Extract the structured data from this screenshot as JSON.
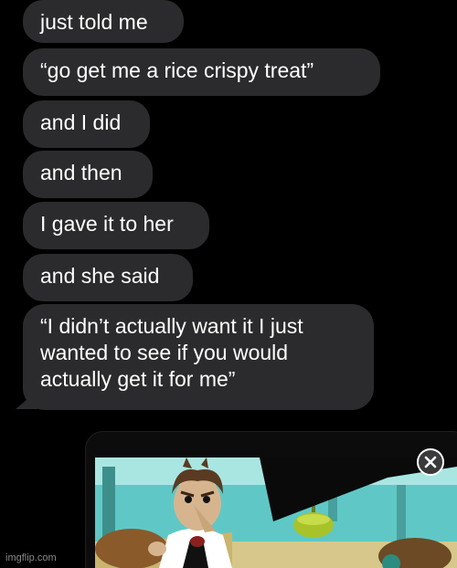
{
  "thread": {
    "messages": [
      {
        "text": "just told me"
      },
      {
        "text": "“go get me a rice crispy treat”"
      },
      {
        "text": "and I did"
      },
      {
        "text": "and then"
      },
      {
        "text": "I gave it to her"
      },
      {
        "text": "and she said"
      },
      {
        "text": "“I didn’t actually want it I just\nwanted to see if you would\nactually get it for me”"
      }
    ],
    "bubble_color": "#2b2b2d",
    "text_color": "#ffffff"
  },
  "media": {
    "icon": "close-icon"
  },
  "watermark": {
    "text": "imgflip.com"
  }
}
